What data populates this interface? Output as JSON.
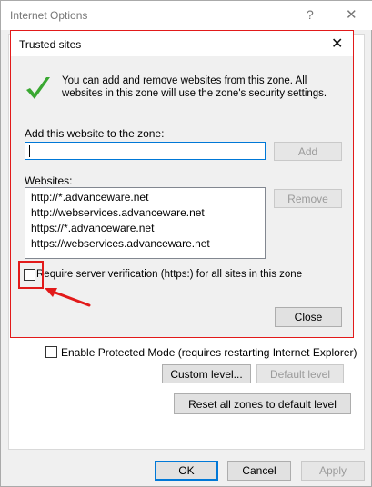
{
  "parent_window": {
    "title": "Internet Options",
    "help_glyph": "?",
    "close_glyph": "✕",
    "enable_protected_mode_label": "Enable Protected Mode (requires restarting Internet Explorer)",
    "custom_level_label": "Custom level...",
    "default_level_label": "Default level",
    "reset_all_label": "Reset all zones to default level",
    "ok_label": "OK",
    "cancel_label": "Cancel",
    "apply_label": "Apply"
  },
  "dialog": {
    "title": "Trusted sites",
    "close_glyph": "✕",
    "info_text": "You can add and remove websites from this zone. All websites in this zone will use the zone's security settings.",
    "add_label": "Add this website to the zone:",
    "add_input_value": "",
    "add_button_label": "Add",
    "websites_label": "Websites:",
    "websites": [
      "http://*.advanceware.net",
      "http://webservices.advanceware.net",
      "https://*.advanceware.net",
      "https://webservices.advanceware.net"
    ],
    "remove_button_label": "Remove",
    "require_verification_label": "Require server verification (https:) for all sites in this zone",
    "require_verification_checked": false,
    "close_button_label": "Close"
  },
  "colors": {
    "annotation_red": "#e21a1a",
    "check_green": "#3aa832",
    "focus_blue": "#0078d7"
  },
  "icons": [
    "checkmark-icon",
    "close-icon",
    "help-icon",
    "arrow-annotation"
  ]
}
